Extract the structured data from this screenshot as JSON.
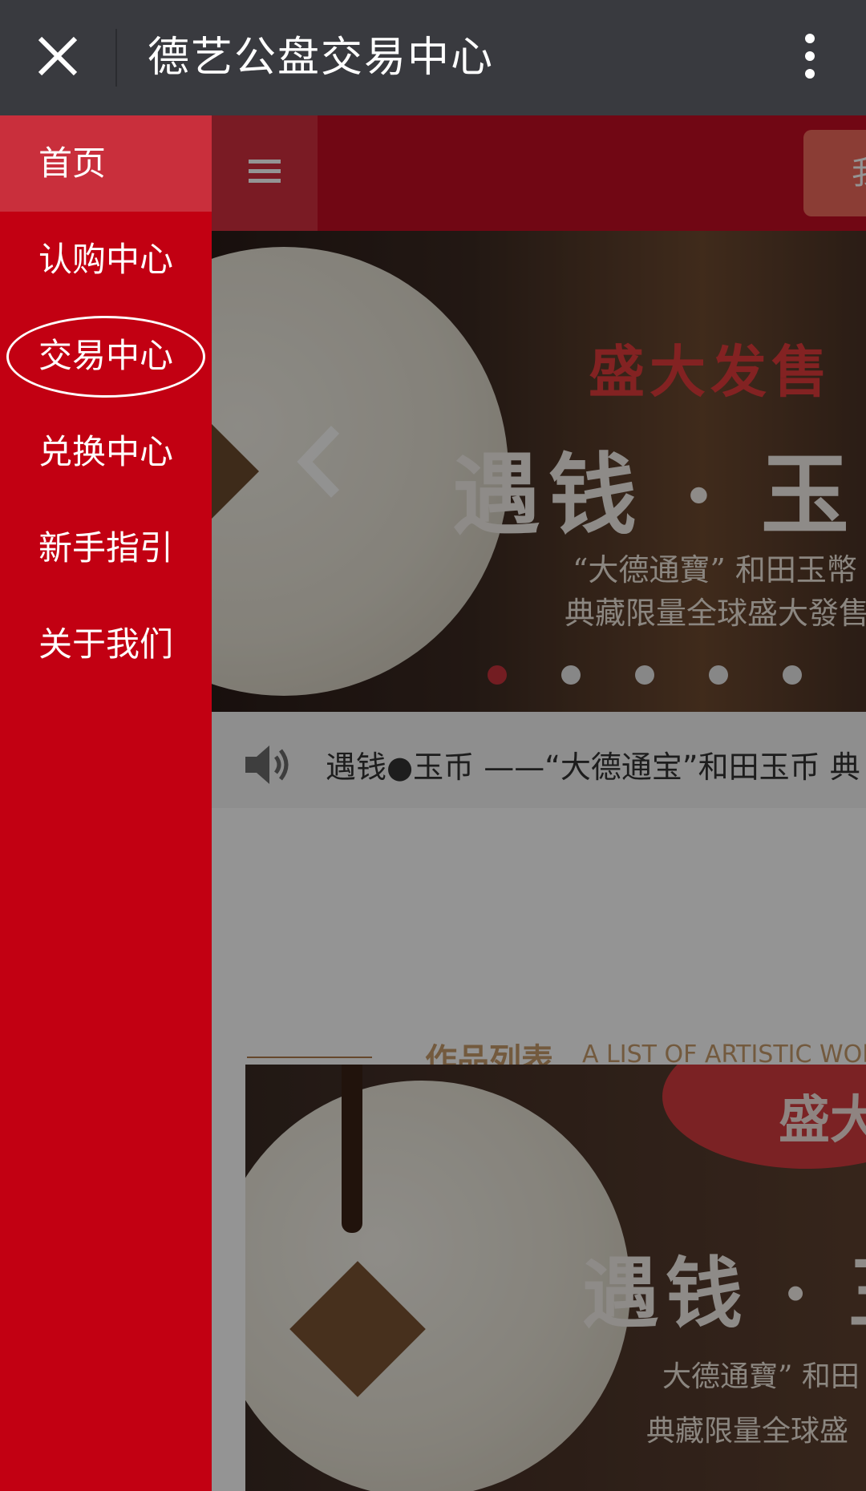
{
  "window": {
    "title": "德艺公盘交易中心",
    "close_icon": "close-icon",
    "more_icon": "more-vertical-icon"
  },
  "drawer": {
    "items": [
      {
        "label": "首页",
        "active": true
      },
      {
        "label": "认购中心",
        "active": false
      },
      {
        "label": "交易中心",
        "active": false,
        "highlighted": true
      },
      {
        "label": "兑换中心",
        "active": false
      },
      {
        "label": "新手指引",
        "active": false
      },
      {
        "label": "关于我们",
        "active": false
      }
    ]
  },
  "navbar": {
    "hamburger_icon": "menu-icon",
    "right_button_label": "我"
  },
  "banner": {
    "sub_title": "盛大发售",
    "main_title": "遇钱 · 玉",
    "line1": "“大德通寶” 和田玉幣",
    "line2": "典藏限量全球盛大發售",
    "dots_total": 5,
    "active_dot": 0,
    "prev_icon": "chevron-left-icon"
  },
  "notice": {
    "icon": "speaker-icon",
    "text": "遇钱●玉币 ——“大德通宝”和田玉币 典"
  },
  "section": {
    "title_cn": "作品列表",
    "title_en": "A LIST OF ARTISTIC WORK"
  },
  "product": {
    "sub_title": "盛大",
    "title": "遇钱 · 玉",
    "line1": "大德通寶” 和田",
    "line2": "典藏限量全球盛"
  },
  "colors": {
    "topbar": "#393a3f",
    "drawer": "#c20012",
    "drawer_active": "#c92f3c",
    "navbar": "#c30d23",
    "accent": "#c69b6b"
  }
}
